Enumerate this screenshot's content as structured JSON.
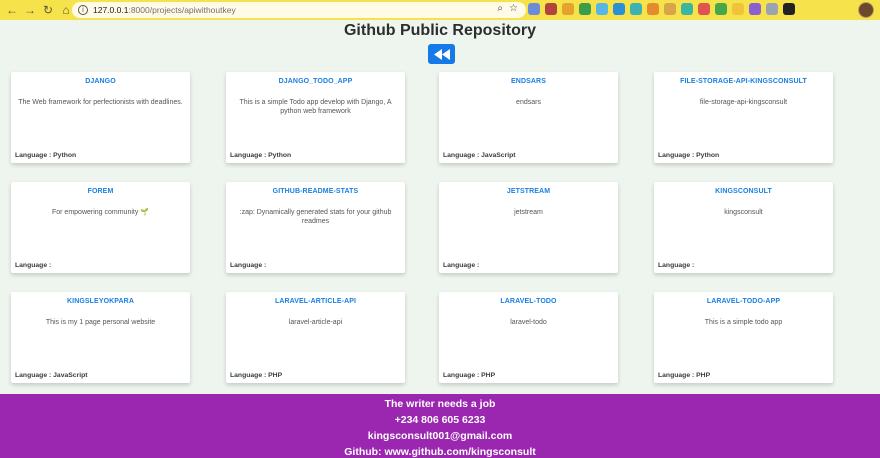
{
  "browser": {
    "url_host": "127.0.0.1",
    "url_path": ":8000/projects/apiwithoutkey"
  },
  "page": {
    "title": "Github Public Repository"
  },
  "repos": [
    {
      "name": "DJANGO",
      "description": "The Web framework for perfectionists with deadlines.",
      "language": "Language : Python"
    },
    {
      "name": "DJANGO_TODO_APP",
      "description": "This is a simple Todo app develop with Django, A python web framework",
      "language": "Language : Python"
    },
    {
      "name": "ENDSARS",
      "description": "endsars",
      "language": "Language : JavaScript"
    },
    {
      "name": "FILE-STORAGE-API-KINGSCONSULT",
      "description": "file-storage-api-kingsconsult",
      "language": "Language : Python"
    },
    {
      "name": "FOREM",
      "description": "For empowering community 🌱",
      "language": "Language :"
    },
    {
      "name": "GITHUB-README-STATS",
      "description": ":zap: Dynamically generated stats for your github readmes",
      "language": "Language :"
    },
    {
      "name": "JETSTREAM",
      "description": "jetstream",
      "language": "Language :"
    },
    {
      "name": "KINGSCONSULT",
      "description": "kingsconsult",
      "language": "Language :"
    },
    {
      "name": "KINGSLEYOKPARA",
      "description": "This is my 1 page personal website",
      "language": "Language : JavaScript"
    },
    {
      "name": "LARAVEL-ARTICLE-API",
      "description": "laravel-article-api",
      "language": "Language : PHP"
    },
    {
      "name": "LARAVEL-TODO",
      "description": "laravel-todo",
      "language": "Language : PHP"
    },
    {
      "name": "LARAVEL-TODO-APP",
      "description": "This is a simple todo app",
      "language": "Language : PHP"
    }
  ],
  "footer": {
    "line1": "The writer needs a job",
    "line2": "+234 806 605 6233",
    "line3": "kingsconsult001@gmail.com",
    "line4": "Github: www.github.com/kingsconsult"
  },
  "colors": {
    "chrome": "#f6e24b",
    "page_bg": "#eef5ee",
    "accent": "#1579e8",
    "repo_title": "#1a7fe0",
    "footer": "#9b27b0"
  }
}
